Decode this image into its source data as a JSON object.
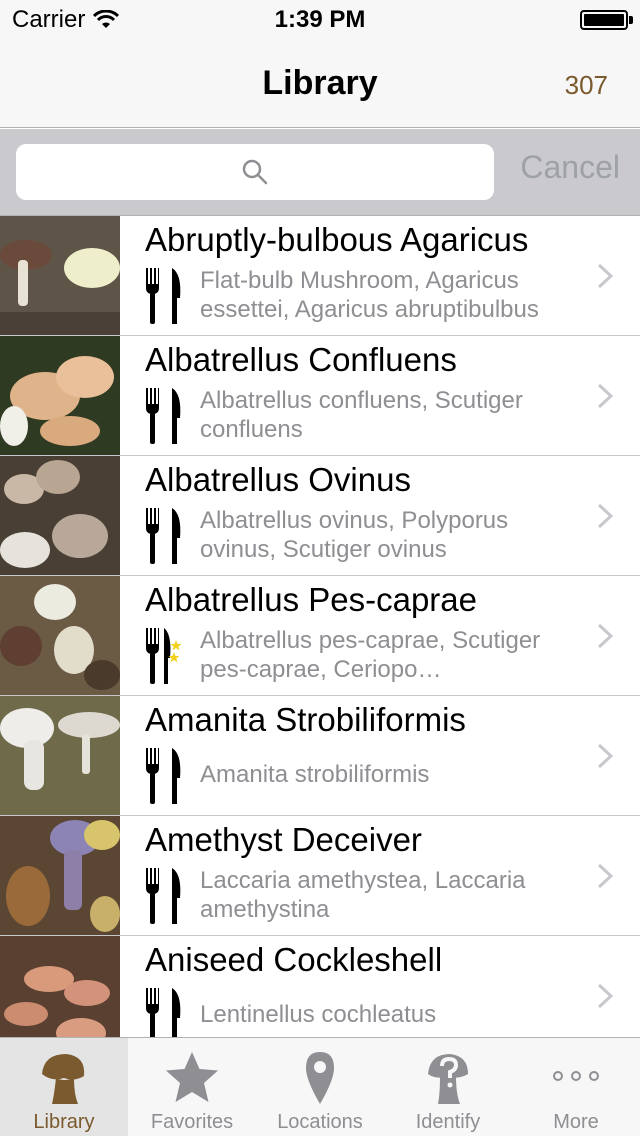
{
  "status_bar": {
    "carrier": "Carrier",
    "time": "1:39 PM"
  },
  "nav": {
    "title": "Library",
    "count": "307"
  },
  "search": {
    "placeholder": "",
    "cancel_label": "Cancel"
  },
  "list": {
    "items": [
      {
        "title": "Abruptly-bulbous Agaricus",
        "subtitle": "Flat-bulb Mushroom, Agaricus essettei, Agaricus abruptibulbus",
        "edibility": "edible"
      },
      {
        "title": "Albatrellus Confluens",
        "subtitle": "Albatrellus confluens, Scutiger confluens",
        "edibility": "edible"
      },
      {
        "title": "Albatrellus Ovinus",
        "subtitle": "Albatrellus ovinus, Polyporus ovinus, Scutiger ovinus",
        "edibility": "edible"
      },
      {
        "title": "Albatrellus Pes-caprae",
        "subtitle": "Albatrellus pes-caprae, Scutiger pes-caprae, Ceriopo…",
        "edibility": "choice-edible"
      },
      {
        "title": "Amanita Strobiliformis",
        "subtitle": "Amanita strobiliformis",
        "edibility": "edible"
      },
      {
        "title": "Amethyst Deceiver",
        "subtitle": "Laccaria amethystea, Laccaria amethystina",
        "edibility": "edible"
      },
      {
        "title": "Aniseed Cockleshell",
        "subtitle": "Lentinellus cochleatus",
        "edibility": "edible"
      }
    ]
  },
  "tabs": [
    {
      "label": "Library",
      "icon": "mushroom-icon",
      "active": true
    },
    {
      "label": "Favorites",
      "icon": "star-icon",
      "active": false
    },
    {
      "label": "Locations",
      "icon": "map-pin-icon",
      "active": false
    },
    {
      "label": "Identify",
      "icon": "question-mushroom-icon",
      "active": false
    },
    {
      "label": "More",
      "icon": "more-dots-icon",
      "active": false
    }
  ],
  "colors": {
    "accent": "#7a5a2e",
    "inactive": "#8e8e93",
    "cancel": "#9ea1a6"
  }
}
